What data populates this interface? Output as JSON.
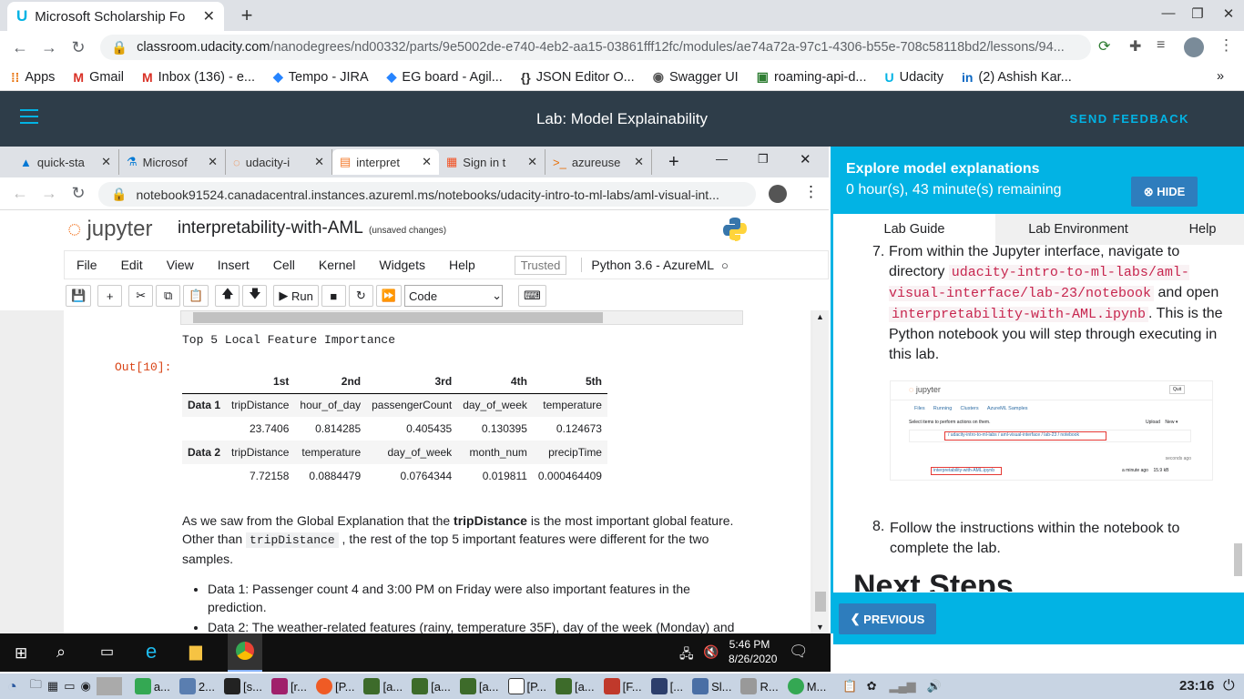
{
  "browser": {
    "tab_title": "Microsoft Scholarship Fo",
    "url_host": "classroom.udacity.com",
    "url_path": "/nanodegrees/nd00332/parts/9e5002de-e740-4eb2-aa15-03861fff12fc/modules/ae74a72a-97c1-4306-b55e-708c58118bd2/lessons/94..."
  },
  "bookmarks": [
    "Apps",
    "Gmail",
    "Inbox (136) - e...",
    "Tempo - JIRA",
    "EG board - Agil...",
    "JSON Editor O...",
    "Swagger UI",
    "roaming-api-d...",
    "Udacity",
    "(2) Ashish Kar..."
  ],
  "udacity": {
    "title": "Lab: Model Explainability",
    "send_feedback": "SEND FEEDBACK"
  },
  "inner_tabs": [
    "quick-sta",
    "Microsof",
    "udacity-i",
    "interpret",
    "Sign in t",
    "azureuse"
  ],
  "inner_url": "notebook91524.canadacentral.instances.azureml.ms/notebooks/udacity-intro-to-ml-labs/aml-visual-int...",
  "jupyter": {
    "logo": "jupyter",
    "notebook_name": "interpretability-with-AML",
    "unsaved": "(unsaved changes)",
    "menu": [
      "File",
      "Edit",
      "View",
      "Insert",
      "Cell",
      "Kernel",
      "Widgets",
      "Help"
    ],
    "trusted": "Trusted",
    "kernel": "Python 3.6 - AzureML",
    "run": "Run",
    "cell_type": "Code"
  },
  "output": {
    "label": "Out[10]:",
    "heading": "Top 5 Local Feature Importance",
    "columns": [
      "",
      "1st",
      "2nd",
      "3rd",
      "4th",
      "5th"
    ],
    "rows": [
      [
        "Data 1",
        "tripDistance",
        "hour_of_day",
        "passengerCount",
        "day_of_week",
        "temperature"
      ],
      [
        "",
        "23.7406",
        "0.814285",
        "0.405435",
        "0.130395",
        "0.124673"
      ],
      [
        "Data 2",
        "tripDistance",
        "temperature",
        "day_of_week",
        "month_num",
        "precipTime"
      ],
      [
        "",
        "7.72158",
        "0.0884479",
        "0.0764344",
        "0.019811",
        "0.000464409"
      ]
    ]
  },
  "text": {
    "p1a": "As we saw from the Global Explanation that the ",
    "p1b": "tripDistance",
    "p1c": " is the most important global feature. Other than ",
    "p1code": "tripDistance",
    "p1d": " , the rest of the top 5 important features were different for the two samples.",
    "b1": "Data 1: Passenger count 4 and 3:00 PM on Friday were also important features in the prediction.",
    "b2": "Data 2: The weather-related features (rainy, temperature 35F), day of the week (Monday) and"
  },
  "panel": {
    "title": "Explore model explanations",
    "time": "0 hour(s), 43 minute(s) remaining",
    "hide": "HIDE",
    "tabs": [
      "Lab Guide",
      "Lab Environment",
      "Help"
    ],
    "s7a": "From within the Jupyter interface, navigate to directory ",
    "s7code1": "udacity-intro-to-ml-labs/aml-visual-interface/lab-23/notebook",
    "s7b": " and open ",
    "s7code2": "interpretability-with-AML.ipynb",
    "s7c": ". This is the Python notebook you will step through executing in this lab.",
    "s8": "Follow the instructions within the notebook to complete the lab.",
    "next": "Next Steps",
    "previous": "PREVIOUS"
  },
  "screenshot": {
    "logo": "jupyter",
    "tabs": [
      "Files",
      "Running",
      "Clusters",
      "AzureML Samples"
    ],
    "select": "Select items to perform actions on them.",
    "path": "/ udacity-intro-to-ml-labs / aml-visual-interface / lab-23 / notebook",
    "file": "interpretability-with-AML.ipynb",
    "modified": "a minute ago",
    "size": "15.9 kB",
    "seconds": "seconds ago",
    "quit": "Quit",
    "upload": "Upload",
    "new": "New"
  },
  "clock": {
    "time": "5:46 PM",
    "date": "8/26/2020"
  },
  "linux_tasks": [
    "a...",
    "2...",
    "[s...",
    "[r...",
    "[P...",
    "[a...",
    "[a...",
    "[a...",
    "[P...",
    "[a...",
    "[F...",
    "[...",
    "Sl...",
    "R...",
    "M..."
  ],
  "linux_time": "23:16",
  "colors": {
    "udacity_dark": "#2e3d49",
    "udacity_blue": "#02b3e4"
  }
}
